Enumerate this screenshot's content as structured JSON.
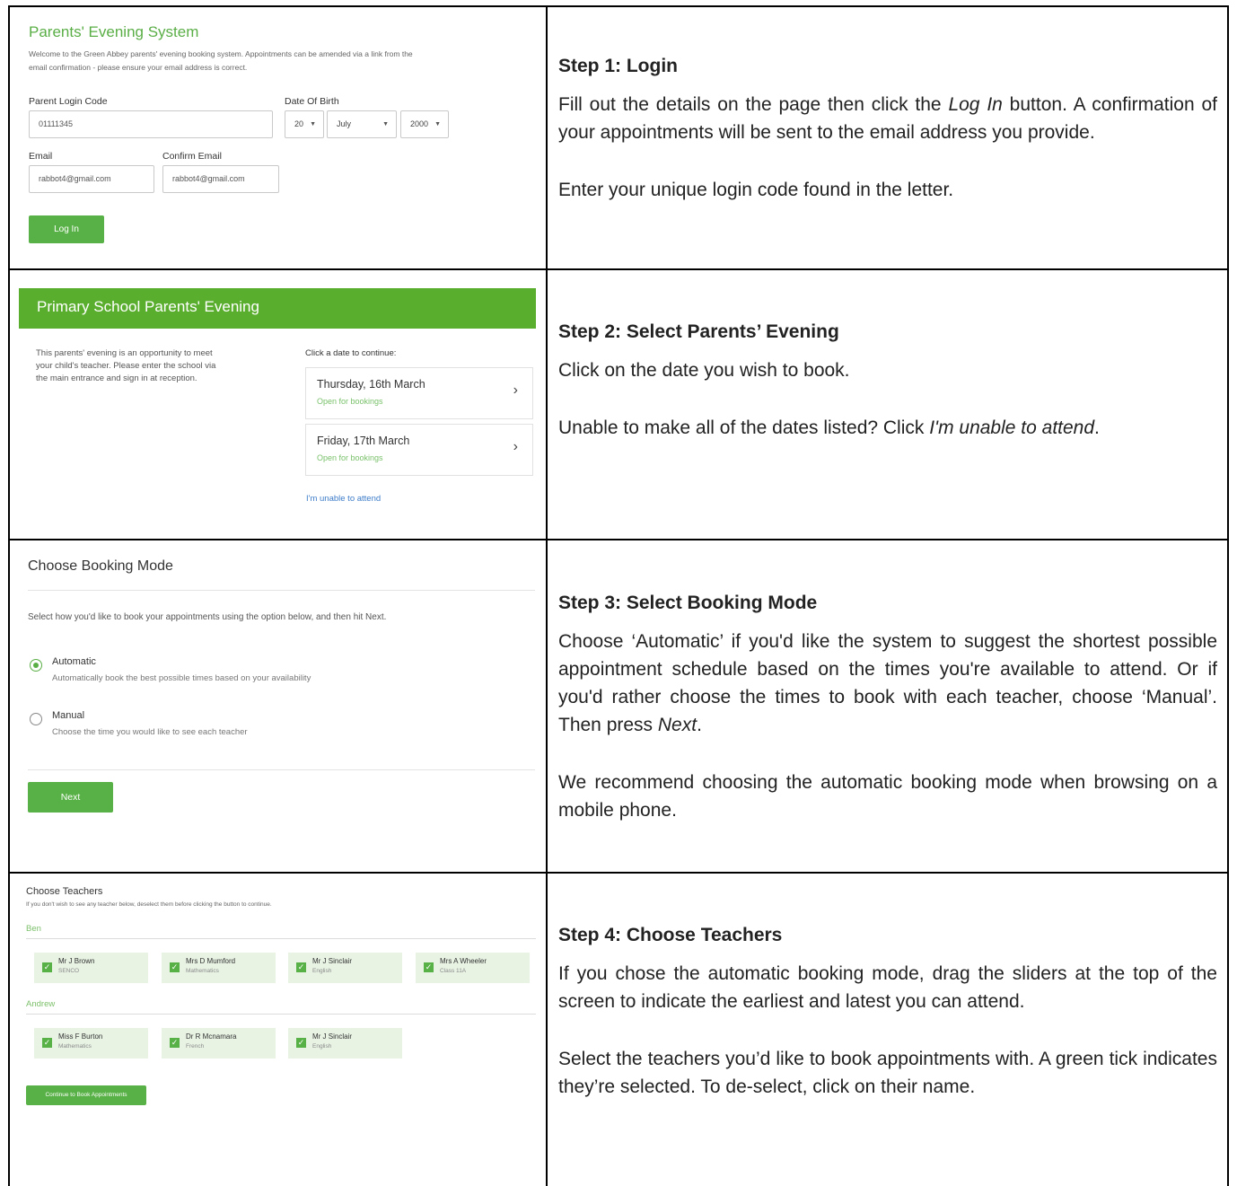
{
  "step1": {
    "ui": {
      "title": "Parents' Evening System",
      "intro_line1": "Welcome to the Green Abbey parents' evening booking system. Appointments can be amended via a link from the",
      "intro_line2": "email confirmation - please ensure your email address is correct.",
      "login_label": "Parent Login Code",
      "login_value": "01111345",
      "dob_label": "Date Of Birth",
      "dob_day": "20",
      "dob_month": "July",
      "dob_year": "2000",
      "email_label": "Email",
      "email_value": "rabbot4@gmail.com",
      "confirm_label": "Confirm Email",
      "confirm_value": "rabbot4@gmail.com",
      "login_button": "Log In"
    },
    "title": "Step 1: Login",
    "para1_a": "Fill out the details on the page then click the ",
    "para1_em": "Log In",
    "para1_b": " button. A confirmation of your appointments will be sent to the email address you provide.",
    "para2": "Enter your unique login code found in the letter."
  },
  "step2": {
    "ui": {
      "header": "Primary School Parents' Evening",
      "desc_line1": "This parents' evening is an opportunity to meet",
      "desc_line2": "your child's teacher. Please enter the school via",
      "desc_line3": "the main entrance and sign in at reception.",
      "click_label": "Click a date to continue:",
      "dates": [
        {
          "date": "Thursday, 16th March",
          "status": "Open for bookings"
        },
        {
          "date": "Friday, 17th March",
          "status": "Open for bookings"
        }
      ],
      "unable_link": "I'm unable to attend"
    },
    "title": "Step 2: Select Parents’ Evening",
    "para1": "Click on the date you wish to book.",
    "para2_a": "Unable to make all of the dates listed? Click ",
    "para2_em": "I'm unable to attend",
    "para2_b": "."
  },
  "step3": {
    "ui": {
      "title": "Choose Booking Mode",
      "instruction": "Select how you'd like to book your appointments using the option below, and then hit Next.",
      "automatic_label": "Automatic",
      "automatic_desc": "Automatically book the best possible times based on your availability",
      "manual_label": "Manual",
      "manual_desc": "Choose the time you would like to see each teacher",
      "next_button": "Next"
    },
    "title": "Step 3: Select Booking Mode",
    "para1_a": "Choose ‘Automatic’ if you'd like the system to suggest the shortest possible appointment schedule based on the times you're available to attend. Or if you'd rather choose the times to book with each teacher, choose ‘Manual’. Then press ",
    "para1_em": "Next",
    "para1_b": ".",
    "para2": "We recommend choosing the automatic booking mode when browsing on a mobile phone."
  },
  "step4": {
    "ui": {
      "title": "Choose Teachers",
      "instruction": "If you don't wish to see any teacher below, deselect them before clicking the button to continue.",
      "children": [
        {
          "name": "Ben",
          "teachers": [
            {
              "name": "Mr J Brown",
              "subject": "SENCO"
            },
            {
              "name": "Mrs D Mumford",
              "subject": "Mathematics"
            },
            {
              "name": "Mr J Sinclair",
              "subject": "English"
            },
            {
              "name": "Mrs A Wheeler",
              "subject": "Class 11A"
            }
          ]
        },
        {
          "name": "Andrew",
          "teachers": [
            {
              "name": "Miss F Burton",
              "subject": "Mathematics"
            },
            {
              "name": "Dr R Mcnamara",
              "subject": "French"
            },
            {
              "name": "Mr J Sinclair",
              "subject": "English"
            }
          ]
        }
      ],
      "continue_button": "Continue to Book Appointments"
    },
    "title": "Step 4: Choose Teachers",
    "para1": "If you chose the automatic booking mode, drag the sliders at the top of the screen to indicate the earliest and latest you can attend.",
    "para2": "Select the teachers you’d like to book appointments with. A green tick indicates they’re selected. To de-select, click on their name."
  }
}
